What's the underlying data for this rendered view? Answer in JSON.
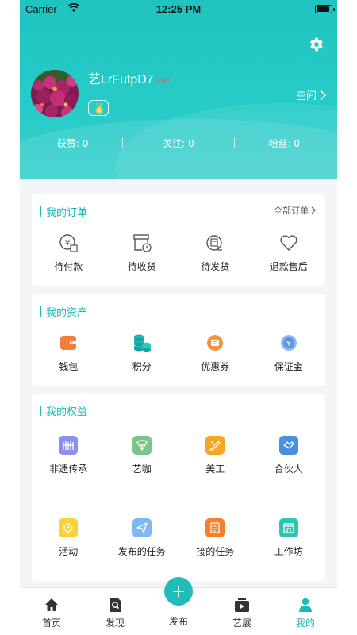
{
  "status_bar": {
    "carrier": "Carrier",
    "time": "12:25 PM",
    "battery_level": 0.9
  },
  "header": {
    "username": "艺LrFutpD7",
    "level": "LV1",
    "space_label": "空间",
    "stats": [
      {
        "label": "获赞: 0"
      },
      {
        "label": "关注: 0"
      },
      {
        "label": "粉丝: 0"
      }
    ]
  },
  "orders": {
    "title": "我的订单",
    "more": "全部订单",
    "items": [
      {
        "label": "待付款",
        "icon": "pending-payment-icon"
      },
      {
        "label": "待收货",
        "icon": "pending-receipt-icon"
      },
      {
        "label": "待发货",
        "icon": "pending-shipment-icon"
      },
      {
        "label": "退款售后",
        "icon": "refund-icon"
      }
    ]
  },
  "assets": {
    "title": "我的资产",
    "items": [
      {
        "label": "钱包",
        "icon": "wallet-icon"
      },
      {
        "label": "积分",
        "icon": "points-icon"
      },
      {
        "label": "优惠券",
        "icon": "coupon-icon"
      },
      {
        "label": "保证金",
        "icon": "deposit-icon"
      }
    ]
  },
  "benefits": {
    "title": "我的权益",
    "items": [
      {
        "label": "非遗传承",
        "icon": "heritage-icon",
        "color": "#8b8ff0"
      },
      {
        "label": "艺咖",
        "icon": "artist-icon",
        "color": "#7cc58a"
      },
      {
        "label": "美工",
        "icon": "designer-icon",
        "color": "#f5a623"
      },
      {
        "label": "合伙人",
        "icon": "partner-icon",
        "color": "#4a90e2"
      },
      {
        "label": "活动",
        "icon": "activity-icon",
        "color": "#f8d23a"
      },
      {
        "label": "发布的任务",
        "icon": "published-task-icon",
        "color": "#7fb8f3"
      },
      {
        "label": "接的任务",
        "icon": "accepted-task-icon",
        "color": "#f57f2a"
      },
      {
        "label": "工作坊",
        "icon": "workshop-icon",
        "color": "#2bc4b5"
      }
    ]
  },
  "tabbar": {
    "items": [
      {
        "label": "首页",
        "icon": "home-icon"
      },
      {
        "label": "发现",
        "icon": "discover-icon"
      },
      {
        "label": "发布",
        "icon": "plus-icon"
      },
      {
        "label": "艺展",
        "icon": "exhibition-icon"
      },
      {
        "label": "我的",
        "icon": "profile-icon"
      }
    ],
    "active": "我的"
  },
  "colors": {
    "accent": "#22b8b5",
    "header_bg": "#27cbc8"
  }
}
